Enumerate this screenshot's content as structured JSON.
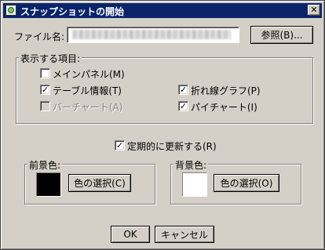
{
  "window": {
    "title": "スナップショットの開始",
    "close_glyph": "✕"
  },
  "filename": {
    "label": "ファイル名:",
    "value": "",
    "browse_label": "参照(B)..."
  },
  "display_items": {
    "legend": "表示する項目:",
    "items": [
      {
        "label": "メインパネル(M)",
        "checked": false,
        "enabled": true
      },
      {
        "label": "テーブル情報(T)",
        "checked": true,
        "enabled": true
      },
      {
        "label": "バーチャート(A)",
        "checked": false,
        "enabled": false
      },
      {
        "label": "折れ線グラフ(P)",
        "checked": true,
        "enabled": true
      },
      {
        "label": "パイチャート(I)",
        "checked": true,
        "enabled": true
      }
    ]
  },
  "periodic_update": {
    "label": "定期的に更新する(R)",
    "checked": true
  },
  "foreground": {
    "legend": "前景色:",
    "color": "#000000",
    "select_label": "色の選択(C)"
  },
  "background": {
    "legend": "背景色:",
    "color": "#ffffff",
    "select_label": "色の選択(O)"
  },
  "buttons": {
    "ok": "OK",
    "cancel": "キャンセル"
  },
  "check_glyph": "✓"
}
